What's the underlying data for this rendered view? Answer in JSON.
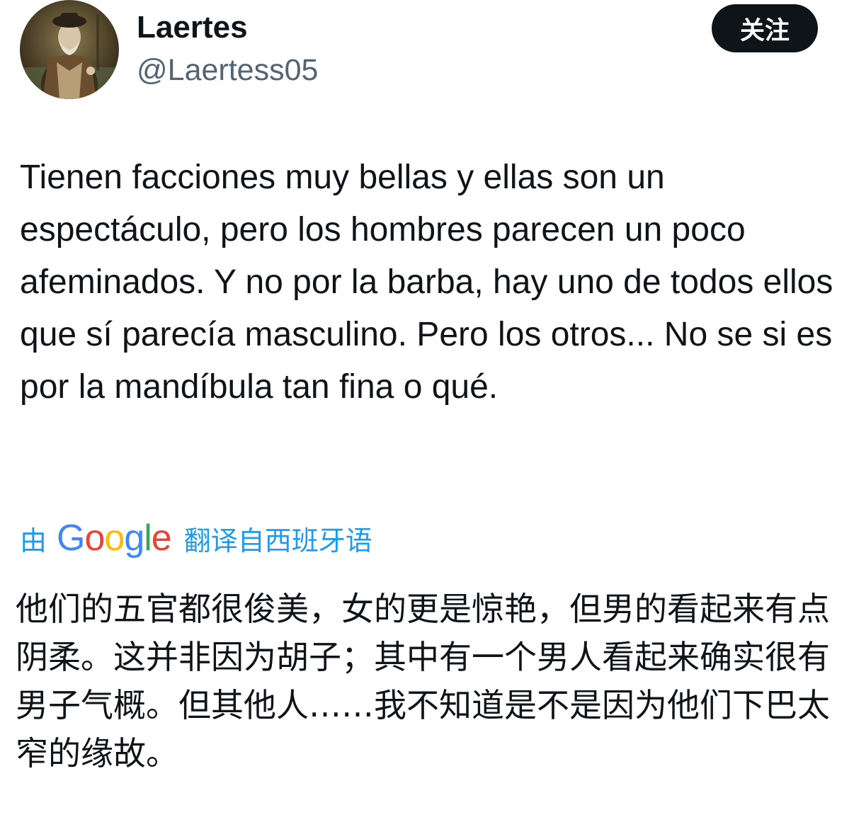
{
  "author": {
    "display_name": "Laertes",
    "handle": "@Laertess05",
    "avatar_icon": "portrait-painting-avatar"
  },
  "follow_button": {
    "label": "关注"
  },
  "tweet": {
    "text": "Tienen facciones muy bellas y ellas son un espectáculo, pero los hombres parecen un poco afeminados. Y no por la barba, hay uno de todos ellos que sí parecía masculino. Pero los otros... No se si es por la mandíbula tan fina o qué."
  },
  "translation": {
    "prefix": "由",
    "provider_letters": [
      "G",
      "o",
      "o",
      "g",
      "l",
      "e"
    ],
    "provider_colors": [
      "#4285F4",
      "#EA4335",
      "#FBBC05",
      "#4285F4",
      "#34A853",
      "#EA4335"
    ],
    "suffix": "翻译自西班牙语",
    "link_color": "#1d9bf0",
    "text": "他们的五官都很俊美，女的更是惊艳，但男的看起来有点阴柔。这并非因为胡子；其中有一个男人看起来确实很有男子气概。但其他人……我不知道是不是因为他们下巴太窄的缘故。"
  }
}
